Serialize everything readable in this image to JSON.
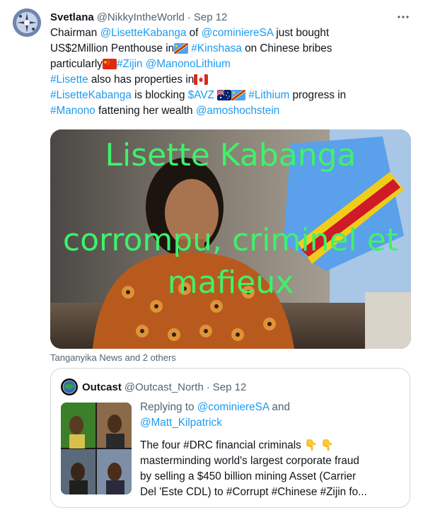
{
  "tweet": {
    "name": "Svetlana",
    "handle": "@NikkyIntheWorld",
    "dot": "·",
    "time": "Sep 12",
    "more_icon": "ellipsis-icon",
    "lines": [
      {
        "a": "Chairman ",
        "b": "@LisetteKabanga",
        "c": " of ",
        "d": "@cominiereSA",
        "e": " just bought"
      },
      {
        "a": "US$2Million Penthouse in",
        "b": "#Kinshasa",
        "c": " on Chinese bribes"
      },
      {
        "a": "particularly",
        "b": "#Zijin",
        "c": "@ManonoLithium"
      },
      {
        "a": "#Lisette",
        "b": " also has properties in"
      },
      {
        "a": "#LisetteKabanga",
        "b": " is blocking ",
        "c": "$AVZ",
        "d": "#Lithium",
        "e": " progress in"
      },
      {
        "a": "#Manono",
        "b": " fattening her wealth ",
        "c": "@amoshochstein"
      }
    ],
    "flags": [
      "flag-drc-icon",
      "flag-china-icon",
      "flag-canada-icon",
      "flag-australia-icon",
      "flag-drc-icon"
    ],
    "media": {
      "overlay_line1": "Lisette Kabanga",
      "overlay_line2": "corrompu, criminel et",
      "overlay_line3": "mafieux"
    },
    "tagged": "Tanganyika News and 2 others"
  },
  "quote": {
    "name": "Outcast",
    "handle": "@Outcast_North",
    "dot": "·",
    "time": "Sep 12",
    "reply_prefix": "Replying to ",
    "reply_to_1": "@cominiereSA",
    "reply_and": " and",
    "reply_to_2": "@Matt_Kilpatrick",
    "body": [
      "The four #DRC financial criminals",
      "masterminding world's largest corporate fraud",
      "by selling a $450 billion mining Asset (Carrier",
      "Del 'Este CDL) to #Corrupt #Chinese #Zijin fo..."
    ]
  },
  "colors": {
    "link": "#1d9bf0",
    "secondary": "#536471",
    "overlay_green": "#3ef26a",
    "border": "#cfd9de"
  }
}
